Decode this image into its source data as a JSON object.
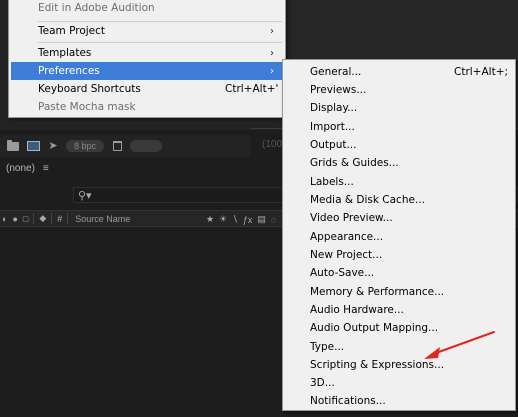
{
  "context_menu": {
    "items": [
      {
        "label": "Edit in Adobe Audition",
        "disabled": true
      },
      {
        "label": "Team Project",
        "submenu": true
      },
      {
        "label": "Templates",
        "submenu": true
      },
      {
        "label": "Preferences",
        "submenu": true,
        "selected": true
      },
      {
        "label": "Keyboard Shortcuts",
        "shortcut": "Ctrl+Alt+'"
      },
      {
        "label": "Paste Mocha mask",
        "disabled": true
      }
    ]
  },
  "preferences_submenu": {
    "items": [
      {
        "label": "General...",
        "shortcut": "Ctrl+Alt+;"
      },
      {
        "label": "Previews..."
      },
      {
        "label": "Display..."
      },
      {
        "label": "Import..."
      },
      {
        "label": "Output..."
      },
      {
        "label": "Grids & Guides..."
      },
      {
        "label": "Labels..."
      },
      {
        "label": "Media & Disk Cache..."
      },
      {
        "label": "Video Preview..."
      },
      {
        "label": "Appearance..."
      },
      {
        "label": "New Project..."
      },
      {
        "label": "Auto-Save..."
      },
      {
        "label": "Memory & Performance..."
      },
      {
        "label": "Audio Hardware..."
      },
      {
        "label": "Audio Output Mapping..."
      },
      {
        "label": "Type..."
      },
      {
        "label": "Scripting & Expressions..."
      },
      {
        "label": "3D..."
      },
      {
        "label": "Notifications..."
      }
    ]
  },
  "project_panel": {
    "bpc_label": "8 bpc",
    "cut_label": "(100",
    "composition_label": "(none)",
    "source_name_header": "Source Name",
    "number_header": "#"
  },
  "annotation": {
    "arrow_color": "#e0261e",
    "points_to": "Scripting & Expressions..."
  },
  "icons": {
    "submenu_arrow": "chevron-right-icon",
    "search": "search-icon"
  }
}
